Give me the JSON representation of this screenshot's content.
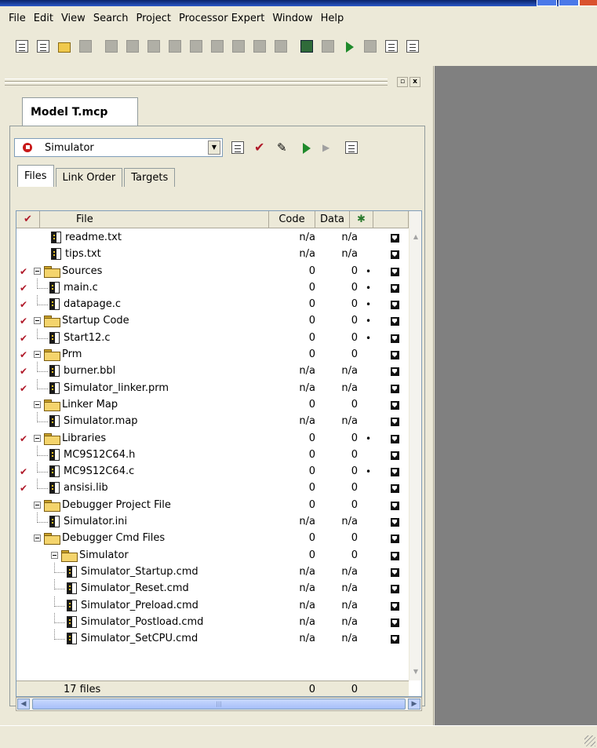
{
  "menu": [
    "File",
    "Edit",
    "View",
    "Search",
    "Project",
    "Processor Expert",
    "Window",
    "Help"
  ],
  "project_tab": "Model T.mcp",
  "target": {
    "selected": "Simulator"
  },
  "subtabs": [
    "Files",
    "Link Order",
    "Targets"
  ],
  "columns": {
    "file": "File",
    "code": "Code",
    "data": "Data"
  },
  "rows": [
    {
      "name": "readme.txt",
      "code": "n/a",
      "data": "n/a",
      "dot": "",
      "checked": false
    },
    {
      "name": "tips.txt",
      "code": "n/a",
      "data": "n/a",
      "dot": "",
      "checked": false
    },
    {
      "name": "Sources",
      "code": "0",
      "data": "0",
      "dot": "•",
      "checked": true
    },
    {
      "name": "main.c",
      "code": "0",
      "data": "0",
      "dot": "•",
      "checked": true
    },
    {
      "name": "datapage.c",
      "code": "0",
      "data": "0",
      "dot": "•",
      "checked": true
    },
    {
      "name": "Startup Code",
      "code": "0",
      "data": "0",
      "dot": "•",
      "checked": true
    },
    {
      "name": "Start12.c",
      "code": "0",
      "data": "0",
      "dot": "•",
      "checked": true
    },
    {
      "name": "Prm",
      "code": "0",
      "data": "0",
      "dot": "",
      "checked": true
    },
    {
      "name": "burner.bbl",
      "code": "n/a",
      "data": "n/a",
      "dot": "",
      "checked": true
    },
    {
      "name": "Simulator_linker.prm",
      "code": "n/a",
      "data": "n/a",
      "dot": "",
      "checked": true
    },
    {
      "name": "Linker Map",
      "code": "0",
      "data": "0",
      "dot": "",
      "checked": false
    },
    {
      "name": "Simulator.map",
      "code": "n/a",
      "data": "n/a",
      "dot": "",
      "checked": false
    },
    {
      "name": "Libraries",
      "code": "0",
      "data": "0",
      "dot": "•",
      "checked": true
    },
    {
      "name": "MC9S12C64.h",
      "code": "0",
      "data": "0",
      "dot": "",
      "checked": false
    },
    {
      "name": "MC9S12C64.c",
      "code": "0",
      "data": "0",
      "dot": "•",
      "checked": true
    },
    {
      "name": "ansisi.lib",
      "code": "0",
      "data": "0",
      "dot": "",
      "checked": true
    },
    {
      "name": "Debugger Project File",
      "code": "0",
      "data": "0",
      "dot": "",
      "checked": false
    },
    {
      "name": "Simulator.ini",
      "code": "n/a",
      "data": "n/a",
      "dot": "",
      "checked": false
    },
    {
      "name": "Debugger Cmd Files",
      "code": "0",
      "data": "0",
      "dot": "",
      "checked": false
    },
    {
      "name": "Simulator",
      "code": "0",
      "data": "0",
      "dot": "",
      "checked": false
    },
    {
      "name": "Simulator_Startup.cmd",
      "code": "n/a",
      "data": "n/a",
      "dot": "",
      "checked": false
    },
    {
      "name": "Simulator_Reset.cmd",
      "code": "n/a",
      "data": "n/a",
      "dot": "",
      "checked": false
    },
    {
      "name": "Simulator_Preload.cmd",
      "code": "n/a",
      "data": "n/a",
      "dot": "",
      "checked": false
    },
    {
      "name": "Simulator_Postload.cmd",
      "code": "n/a",
      "data": "n/a",
      "dot": "",
      "checked": false
    },
    {
      "name": "Simulator_SetCPU.cmd",
      "code": "n/a",
      "data": "n/a",
      "dot": "",
      "checked": false
    }
  ],
  "footer": {
    "files": "17 files",
    "code": "0",
    "data": "0"
  },
  "colors": {
    "check": "#B01A2A",
    "workspace": "#808080",
    "chrome": "#ECE9D8"
  }
}
